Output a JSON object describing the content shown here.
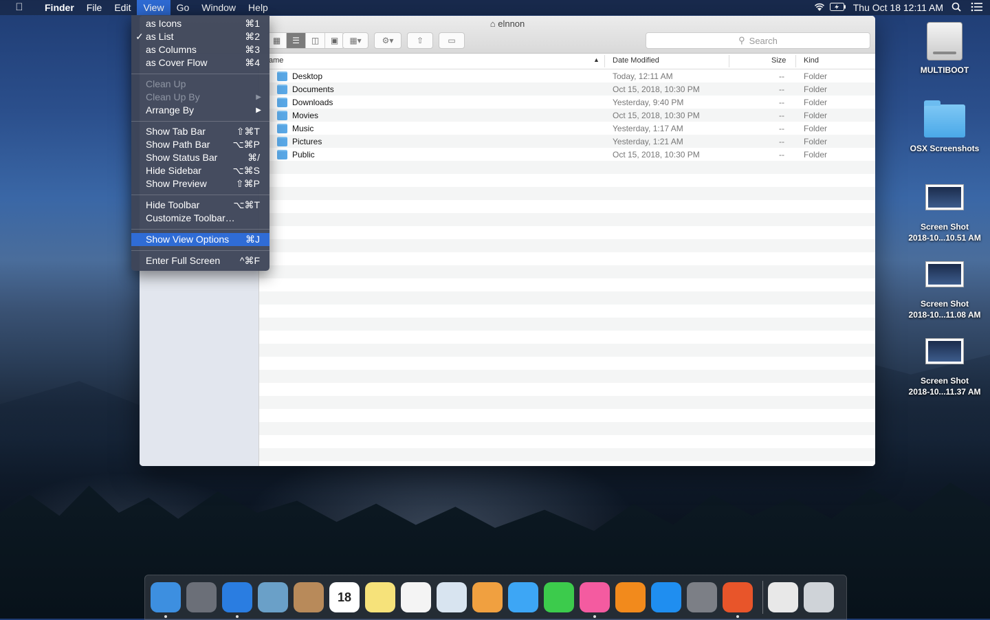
{
  "menubar": {
    "app": "Finder",
    "items": [
      "File",
      "Edit",
      "View",
      "Go",
      "Window",
      "Help"
    ],
    "clock": "Thu Oct 18  12:11 AM"
  },
  "window": {
    "title": "elnnon",
    "search_placeholder": "Search",
    "columns": {
      "name": "ame",
      "date": "Date Modified",
      "size": "Size",
      "kind": "Kind"
    },
    "rows": [
      {
        "name": "Desktop",
        "date": "Today, 12:11 AM",
        "size": "--",
        "kind": "Folder"
      },
      {
        "name": "Documents",
        "date": "Oct 15, 2018, 10:30 PM",
        "size": "--",
        "kind": "Folder"
      },
      {
        "name": "Downloads",
        "date": "Yesterday, 9:40 PM",
        "size": "--",
        "kind": "Folder"
      },
      {
        "name": "Movies",
        "date": "Oct 15, 2018, 10:30 PM",
        "size": "--",
        "kind": "Folder"
      },
      {
        "name": "Music",
        "date": "Yesterday, 1:17 AM",
        "size": "--",
        "kind": "Folder"
      },
      {
        "name": "Pictures",
        "date": "Yesterday, 1:21 AM",
        "size": "--",
        "kind": "Folder"
      },
      {
        "name": "Public",
        "date": "Oct 15, 2018, 10:30 PM",
        "size": "--",
        "kind": "Folder"
      }
    ]
  },
  "view_menu": {
    "items": [
      {
        "label": "as Icons",
        "shortcut": "⌘1"
      },
      {
        "label": "as List",
        "shortcut": "⌘2",
        "checked": true
      },
      {
        "label": "as Columns",
        "shortcut": "⌘3"
      },
      {
        "label": "as Cover Flow",
        "shortcut": "⌘4"
      },
      {
        "label": "Clean Up",
        "disabled": true
      },
      {
        "label": "Clean Up By",
        "disabled": true,
        "submenu": true
      },
      {
        "label": "Arrange By",
        "submenu": true
      },
      {
        "label": "Show Tab Bar",
        "shortcut": "⇧⌘T"
      },
      {
        "label": "Show Path Bar",
        "shortcut": "⌥⌘P"
      },
      {
        "label": "Show Status Bar",
        "shortcut": "⌘/"
      },
      {
        "label": "Hide Sidebar",
        "shortcut": "⌥⌘S"
      },
      {
        "label": "Show Preview",
        "shortcut": "⇧⌘P"
      },
      {
        "label": "Hide Toolbar",
        "shortcut": "⌥⌘T"
      },
      {
        "label": "Customize Toolbar…"
      },
      {
        "label": "Show View Options",
        "shortcut": "⌘J",
        "highlighted": true
      },
      {
        "label": "Enter Full Screen",
        "shortcut": "^⌘F"
      }
    ]
  },
  "desktop": {
    "icons": [
      {
        "line1": "MULTIBOOT",
        "line2": ""
      },
      {
        "line1": "OSX Screenshots",
        "line2": ""
      },
      {
        "line1": "Screen Shot",
        "line2": "2018-10...10.51 AM"
      },
      {
        "line1": "Screen Shot",
        "line2": "2018-10...11.08 AM"
      },
      {
        "line1": "Screen Shot",
        "line2": "2018-10...11.37 AM"
      }
    ]
  },
  "dock": {
    "apps": [
      {
        "name": "finder-icon",
        "color": "#3d8fe0",
        "running": true
      },
      {
        "name": "launchpad-icon",
        "color": "#6b6f78",
        "running": false
      },
      {
        "name": "safari-icon",
        "color": "#2a7de1",
        "running": true
      },
      {
        "name": "mail-icon",
        "color": "#6aa0c8",
        "running": false
      },
      {
        "name": "contacts-icon",
        "color": "#b88a5a",
        "running": false
      },
      {
        "name": "calendar-icon",
        "color": "#ffffff",
        "running": false,
        "text": "18"
      },
      {
        "name": "notes-icon",
        "color": "#f6e27a",
        "running": false
      },
      {
        "name": "reminders-icon",
        "color": "#f4f4f4",
        "running": false
      },
      {
        "name": "preview-icon",
        "color": "#d8e4f0",
        "running": false
      },
      {
        "name": "photos-icon",
        "color": "#f0a040",
        "running": false
      },
      {
        "name": "messages-icon",
        "color": "#3da6f5",
        "running": false
      },
      {
        "name": "facetime-icon",
        "color": "#3ccb4c",
        "running": false
      },
      {
        "name": "itunes-icon",
        "color": "#f45ba0",
        "running": true
      },
      {
        "name": "ibooks-icon",
        "color": "#f28a1c",
        "running": false
      },
      {
        "name": "app-store-icon",
        "color": "#1f8ef0",
        "running": false
      },
      {
        "name": "system-preferences-icon",
        "color": "#7c7f86",
        "running": false
      },
      {
        "name": "firefox-icon",
        "color": "#e8552a",
        "running": true
      },
      {
        "name": "documents-stack-icon",
        "color": "#e8e8e8",
        "running": false
      },
      {
        "name": "trash-icon",
        "color": "#cfd3d8",
        "running": false
      }
    ]
  }
}
